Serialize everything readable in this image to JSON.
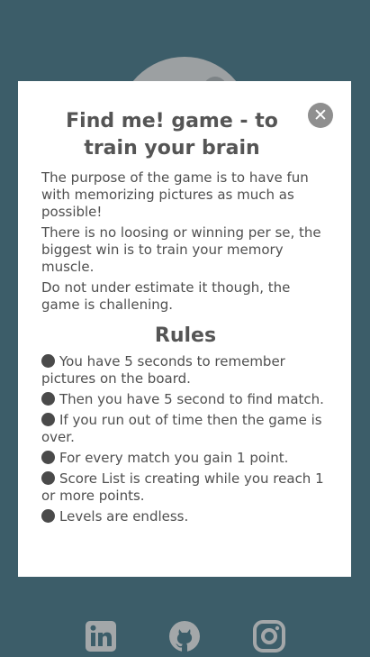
{
  "modal": {
    "close_icon": "close-icon",
    "title": "Find me! game - to train your brain",
    "paragraphs": [
      "The purpose of the game is to have fun with memorizing pictures as much as possible!",
      "There is no loosing or winning per se, the biggest win is to train your memory muscle.",
      "Do not under estimate it though, the game is challening."
    ],
    "rules_title": "Rules",
    "rules": [
      "You have 5 seconds to remember pictures on the board.",
      "Then you have 5 second to find match.",
      "If you run out of time then the game is over.",
      "For every match you gain 1 point.",
      "Score List is creating while you reach 1 or more points.",
      "Levels are endless."
    ]
  },
  "footer": {
    "icons": [
      "linkedin-icon",
      "github-icon",
      "instagram-icon"
    ]
  },
  "colors": {
    "page_background": "#3c5d69",
    "modal_background": "#ffffff",
    "text": "#4f4f4f",
    "icon": "#a3a7a9"
  }
}
